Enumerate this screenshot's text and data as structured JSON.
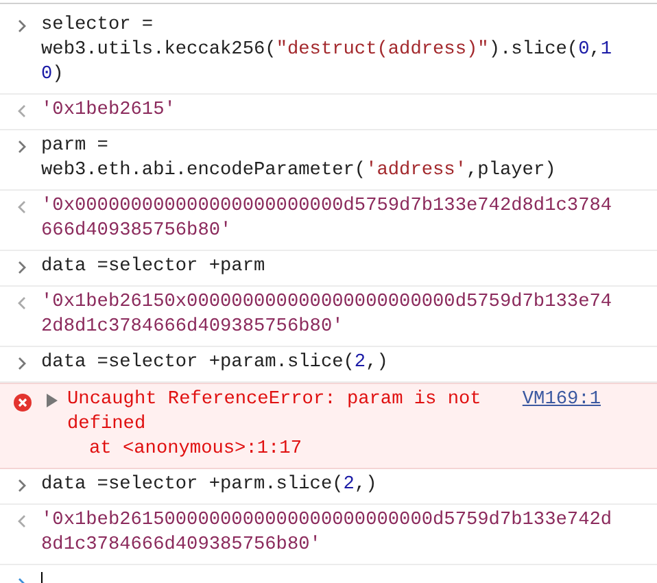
{
  "console": {
    "entries": [
      {
        "kind": "input",
        "parts": [
          {
            "kind": "plain",
            "text": "selector = web3.utils.keccak256("
          },
          {
            "kind": "string",
            "text": "\"destruct(address)\""
          },
          {
            "kind": "plain",
            "text": ").slice("
          },
          {
            "kind": "number",
            "text": "0"
          },
          {
            "kind": "plain",
            "text": ","
          },
          {
            "kind": "number",
            "text": "10"
          },
          {
            "kind": "plain",
            "text": ")"
          }
        ]
      },
      {
        "kind": "result",
        "text": "'0x1beb2615'"
      },
      {
        "kind": "input",
        "parts": [
          {
            "kind": "plain",
            "text": "parm = web3.eth.abi.encodeParameter("
          },
          {
            "kind": "string",
            "text": "'address'"
          },
          {
            "kind": "plain",
            "text": ",player)"
          }
        ]
      },
      {
        "kind": "result",
        "text": "'0x000000000000000000000000d5759d7b133e742d8d1c3784666d409385756b80'"
      },
      {
        "kind": "input",
        "parts": [
          {
            "kind": "plain",
            "text": "data =selector +parm"
          }
        ]
      },
      {
        "kind": "result",
        "text": "'0x1beb26150x000000000000000000000000d5759d7b133e742d8d1c3784666d409385756b80'"
      },
      {
        "kind": "input",
        "parts": [
          {
            "kind": "plain",
            "text": "data =selector +param.slice("
          },
          {
            "kind": "number",
            "text": "2"
          },
          {
            "kind": "plain",
            "text": ",)"
          }
        ]
      },
      {
        "kind": "error",
        "text": "Uncaught ReferenceError: param is not defined",
        "trace": "at <anonymous>:1:17",
        "source": "VM169:1",
        "expanded": false
      },
      {
        "kind": "input",
        "parts": [
          {
            "kind": "plain",
            "text": "data =selector +parm.slice("
          },
          {
            "kind": "number",
            "text": "2"
          },
          {
            "kind": "plain",
            "text": ",)"
          }
        ]
      },
      {
        "kind": "result",
        "text": "'0x1beb2615000000000000000000000000d5759d7b133e742d8d1c3784666d409385756b80'"
      }
    ]
  }
}
